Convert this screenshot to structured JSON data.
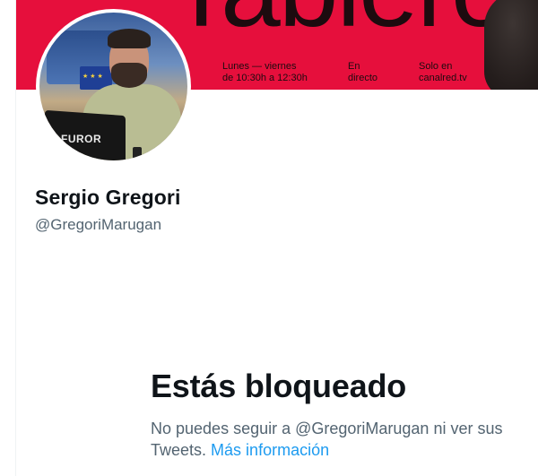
{
  "banner": {
    "headline": "Tablero",
    "schedule_line1": "Lunes — viernes",
    "schedule_line2": "de 10:30h a 12:30h",
    "live_line1": "En",
    "live_line2": "directo",
    "site_line1": "Solo en",
    "site_line2": "canalred.tv",
    "accent_color": "#e60f3c"
  },
  "avatar": {
    "laptop_text": "FUROR"
  },
  "profile": {
    "display_name": "Sergio Gregori",
    "handle": "@GregoriMarugan"
  },
  "blocked": {
    "title": "Estás bloqueado",
    "message": "No puedes seguir a @GregoriMarugan ni ver sus Tweets.",
    "link_label": "Más información",
    "link_color": "#1d9bf0"
  }
}
